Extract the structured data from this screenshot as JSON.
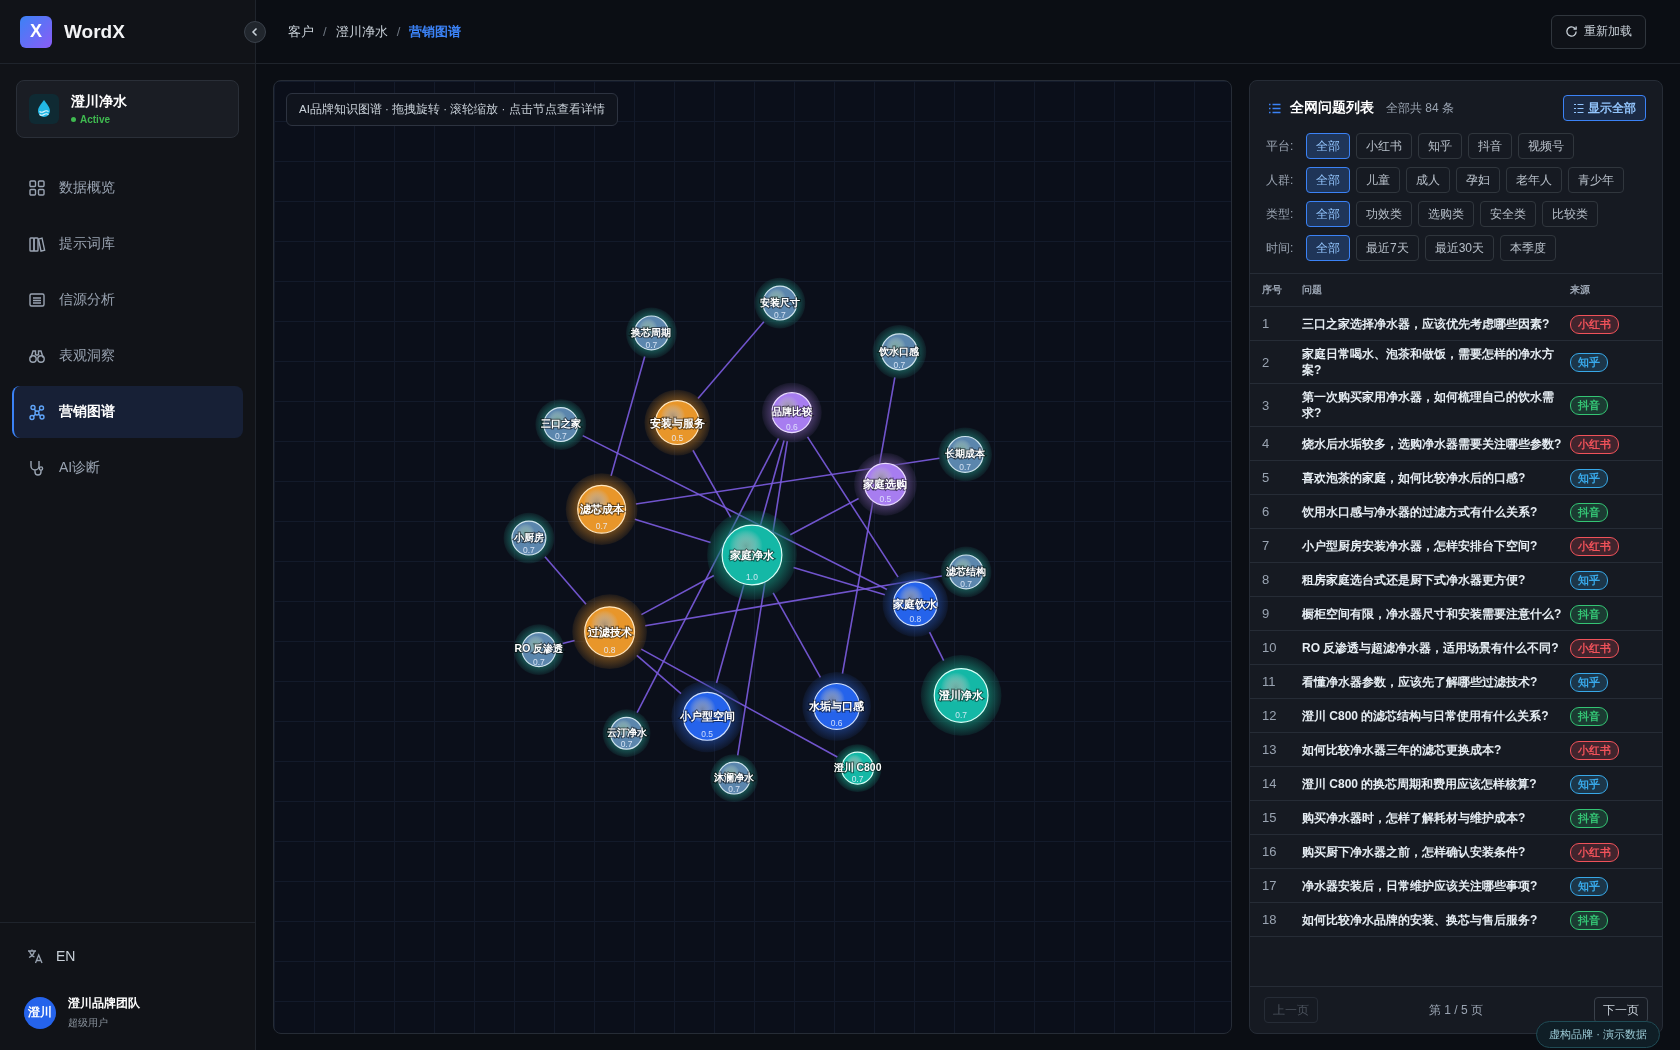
{
  "app": {
    "logo": "X",
    "name": "WordX"
  },
  "brand": {
    "name": "澄川净水",
    "status": "Active"
  },
  "nav": [
    {
      "label": "数据概览",
      "kind": "grid",
      "selected": false
    },
    {
      "label": "提示词库",
      "kind": "books",
      "selected": false
    },
    {
      "label": "信源分析",
      "kind": "list",
      "selected": false
    },
    {
      "label": "表观洞察",
      "kind": "binoculars",
      "selected": false
    },
    {
      "label": "营销图谱",
      "kind": "graph",
      "selected": true
    },
    {
      "label": "AI诊断",
      "kind": "stethoscope",
      "selected": false
    }
  ],
  "language": "EN",
  "user": {
    "avatar": "澄川",
    "name": "澄川品牌团队",
    "role": "超级用户"
  },
  "breadcrumb_separator": "/",
  "breadcrumb": [
    {
      "label": "客户",
      "selected": false
    },
    {
      "label": "澄川净水",
      "selected": false
    },
    {
      "label": "营销图谱",
      "selected": true
    }
  ],
  "reload_button": "重新加载",
  "graph": {
    "caption": "AI品牌知识图谱 · 拖拽旋转 · 滚轮缩放 · 点击节点查看详情",
    "nodes": [
      {
        "label": "安装尺寸",
        "weight": "0.7",
        "kind": "keyword"
      },
      {
        "label": "换芯周期",
        "weight": "0.7",
        "kind": "keyword"
      },
      {
        "label": "饮水口感",
        "weight": "0.7",
        "kind": "keyword"
      },
      {
        "label": "三口之家",
        "weight": "0.7",
        "kind": "keyword"
      },
      {
        "label": "安装与服务",
        "weight": "0.5",
        "kind": "concern"
      },
      {
        "label": "品牌比较",
        "weight": "0.6",
        "kind": "compare"
      },
      {
        "label": "长期成本",
        "weight": "0.7",
        "kind": "keyword"
      },
      {
        "label": "家庭选购",
        "weight": "0.5",
        "kind": "compare"
      },
      {
        "label": "滤芯成本",
        "weight": "0.7",
        "kind": "concern"
      },
      {
        "label": "小厨房",
        "weight": "0.7",
        "kind": "keyword"
      },
      {
        "label": "家庭净水",
        "weight": "1.0",
        "kind": "core"
      },
      {
        "label": "滤芯结构",
        "weight": "0.7",
        "kind": "keyword"
      },
      {
        "label": "家庭饮水",
        "weight": "0.8",
        "kind": "scene"
      },
      {
        "label": "过滤技术",
        "weight": "0.8",
        "kind": "concern"
      },
      {
        "label": "RO 反渗透",
        "weight": "0.7",
        "kind": "keyword"
      },
      {
        "label": "小户型空间",
        "weight": "0.5",
        "kind": "scene"
      },
      {
        "label": "水垢与口感",
        "weight": "0.6",
        "kind": "scene"
      },
      {
        "label": "澄川净水",
        "weight": "0.7",
        "kind": "core"
      },
      {
        "label": "云汀净水",
        "weight": "0.7",
        "kind": "keyword"
      },
      {
        "label": "沐澜净水",
        "weight": "0.7",
        "kind": "keyword"
      },
      {
        "label": "澄川 C800",
        "weight": "0.7",
        "kind": "core"
      }
    ]
  },
  "questions": {
    "title": "全网问题列表",
    "count": "全部共 84 条",
    "show_all_button": "显示全部",
    "filters": [
      {
        "label": "平台:",
        "options": [
          {
            "label": "全部",
            "selected": true
          },
          {
            "label": "小红书",
            "selected": false
          },
          {
            "label": "知乎",
            "selected": false
          },
          {
            "label": "抖音",
            "selected": false
          },
          {
            "label": "视频号",
            "selected": false
          }
        ]
      },
      {
        "label": "人群:",
        "options": [
          {
            "label": "全部",
            "selected": true
          },
          {
            "label": "儿童",
            "selected": false
          },
          {
            "label": "成人",
            "selected": false
          },
          {
            "label": "孕妇",
            "selected": false
          },
          {
            "label": "老年人",
            "selected": false
          },
          {
            "label": "青少年",
            "selected": false
          }
        ]
      },
      {
        "label": "类型:",
        "options": [
          {
            "label": "全部",
            "selected": true
          },
          {
            "label": "功效类",
            "selected": false
          },
          {
            "label": "选购类",
            "selected": false
          },
          {
            "label": "安全类",
            "selected": false
          },
          {
            "label": "比较类",
            "selected": false
          }
        ]
      },
      {
        "label": "时间:",
        "options": [
          {
            "label": "全部",
            "selected": true
          },
          {
            "label": "最近7天",
            "selected": false
          },
          {
            "label": "最近30天",
            "selected": false
          },
          {
            "label": "本季度",
            "selected": false
          }
        ]
      }
    ],
    "columns": [
      "序号",
      "问题",
      "来源"
    ],
    "rows": [
      {
        "index": "1",
        "question": "三口之家选择净水器，应该优先考虑哪些因素?",
        "source": "小红书",
        "color": "#f0525a"
      },
      {
        "index": "2",
        "question": "家庭日常喝水、泡茶和做饭，需要怎样的净水方案?",
        "source": "知乎",
        "color": "#38a8e8"
      },
      {
        "index": "3",
        "question": "第一次购买家用净水器，如何梳理自己的饮水需求?",
        "source": "抖音",
        "color": "#34c474"
      },
      {
        "index": "4",
        "question": "烧水后水垢较多，选购净水器需要关注哪些参数?",
        "source": "小红书",
        "color": "#f0525a"
      },
      {
        "index": "5",
        "question": "喜欢泡茶的家庭，如何比较净水后的口感?",
        "source": "知乎",
        "color": "#38a8e8"
      },
      {
        "index": "6",
        "question": "饮用水口感与净水器的过滤方式有什么关系?",
        "source": "抖音",
        "color": "#34c474"
      },
      {
        "index": "7",
        "question": "小户型厨房安装净水器，怎样安排台下空间?",
        "source": "小红书",
        "color": "#f0525a"
      },
      {
        "index": "8",
        "question": "租房家庭选台式还是厨下式净水器更方便?",
        "source": "知乎",
        "color": "#38a8e8"
      },
      {
        "index": "9",
        "question": "橱柜空间有限，净水器尺寸和安装需要注意什么?",
        "source": "抖音",
        "color": "#34c474"
      },
      {
        "index": "10",
        "question": "RO 反渗透与超滤净水器，适用场景有什么不同?",
        "source": "小红书",
        "color": "#f0525a"
      },
      {
        "index": "11",
        "question": "看懂净水器参数，应该先了解哪些过滤技术?",
        "source": "知乎",
        "color": "#38a8e8"
      },
      {
        "index": "12",
        "question": "澄川 C800 的滤芯结构与日常使用有什么关系?",
        "source": "抖音",
        "color": "#34c474"
      },
      {
        "index": "13",
        "question": "如何比较净水器三年的滤芯更换成本?",
        "source": "小红书",
        "color": "#f0525a"
      },
      {
        "index": "14",
        "question": "澄川 C800 的换芯周期和费用应该怎样核算?",
        "source": "知乎",
        "color": "#38a8e8"
      },
      {
        "index": "15",
        "question": "购买净水器时，怎样了解耗材与维护成本?",
        "source": "抖音",
        "color": "#34c474"
      },
      {
        "index": "16",
        "question": "购买厨下净水器之前，怎样确认安装条件?",
        "source": "小红书",
        "color": "#f0525a"
      },
      {
        "index": "17",
        "question": "净水器安装后，日常维护应该关注哪些事项?",
        "source": "知乎",
        "color": "#38a8e8"
      },
      {
        "index": "18",
        "question": "如何比较净水品牌的安装、换芯与售后服务?",
        "source": "抖音",
        "color": "#34c474"
      }
    ],
    "pagination": {
      "prev": {
        "label": "上一页",
        "disabled": true
      },
      "page": "第 1 / 5 页",
      "next": {
        "label": "下一页",
        "disabled": false
      }
    }
  },
  "demo_badge": "虚构品牌 · 演示数据"
}
